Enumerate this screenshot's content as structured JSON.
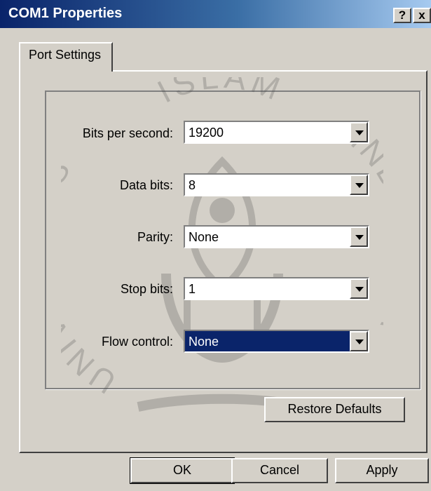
{
  "window": {
    "title": "COM1 Properties",
    "help_label": "?",
    "close_label": "x"
  },
  "tabs": [
    {
      "label": "Port Settings",
      "active": true
    }
  ],
  "settings": [
    {
      "label": "Bits per second:",
      "value": "19200"
    },
    {
      "label": "Data bits:",
      "value": "8"
    },
    {
      "label": "Parity:",
      "value": "None"
    },
    {
      "label": "Stop bits:",
      "value": "1"
    },
    {
      "label": "Flow control:",
      "value": "None",
      "focused": true
    }
  ],
  "buttons": {
    "restore_defaults": "Restore Defaults",
    "ok": "OK",
    "cancel": "Cancel",
    "apply": "Apply"
  },
  "watermark": {
    "text_top": "ISLAM",
    "text_left": "UNIVERSITAS",
    "text_right": "INDONESIA"
  },
  "colors": {
    "titlebar_start": "#0a246a",
    "titlebar_end": "#a6caf0",
    "face": "#d4d0c8",
    "selection": "#0a246a"
  }
}
